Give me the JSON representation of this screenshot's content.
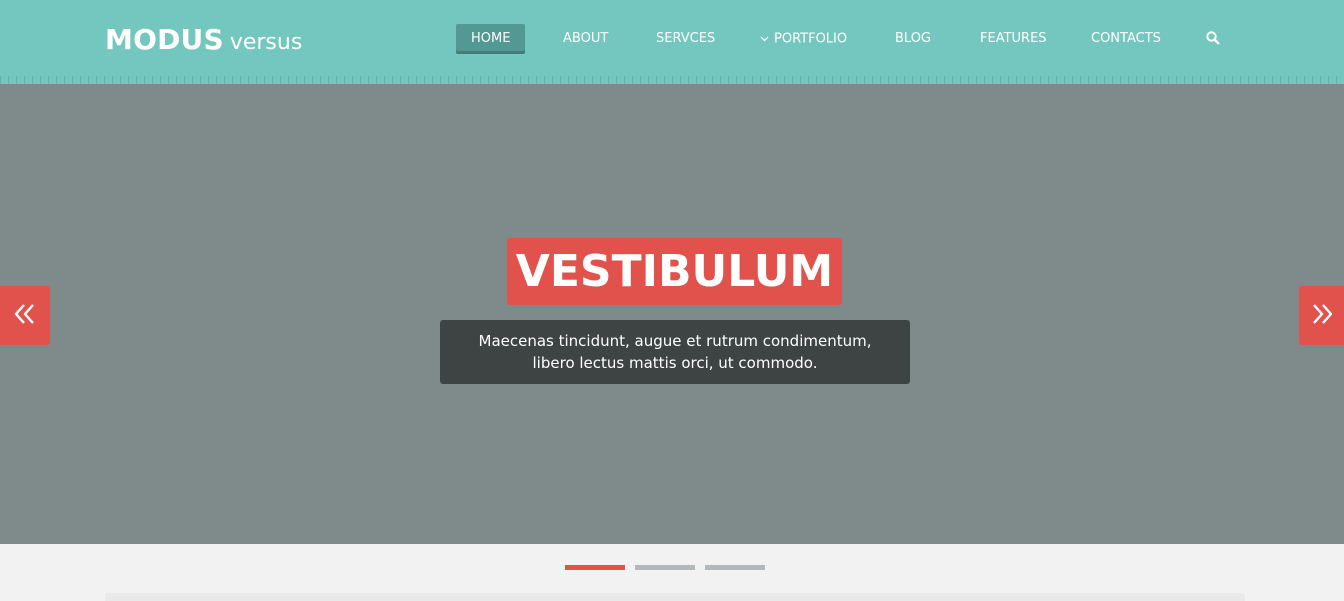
{
  "header": {
    "logo_bold": "MODUS",
    "logo_light": "versus",
    "nav": {
      "home": "HOME",
      "about": "ABOUT",
      "services": "SERVCES",
      "portfolio": "PORTFOLIO",
      "blog": "BLOG",
      "features": "FEATURES",
      "contacts": "CONTACTS"
    },
    "icons": {
      "search": "search-icon",
      "portfolio_dropdown": "chevron-down-icon"
    }
  },
  "slider": {
    "title": "VESTIBULUM",
    "caption": "Maecenas tincidunt, augue et rutrum condimentum, libero lectus mattis orci, ut commodo.",
    "icons": {
      "prev": "double-chevron-left-icon",
      "next": "double-chevron-right-icon"
    },
    "active_slide": 1,
    "slide_count": 3
  },
  "colors": {
    "header": "#74c7bf",
    "nav_active": "#519992",
    "accent": "#e0524b",
    "hero_bg": "#7f8b8a",
    "caption_bg": "#3d4443",
    "indicator_inactive": "#b3b8bb"
  }
}
